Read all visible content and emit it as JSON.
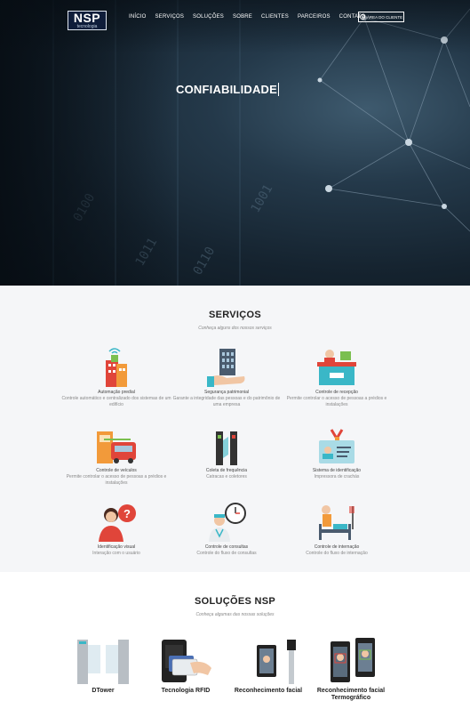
{
  "header": {
    "logo_text": "NSP",
    "logo_sub": "tecnologia",
    "nav": [
      "INÍCIO",
      "SERVIÇOS",
      "SOLUÇÕES",
      "SOBRE",
      "CLIENTES",
      "PARCEIROS",
      "CONTATO"
    ],
    "client_button": "ÁREA DO CLIENTE"
  },
  "hero": {
    "title": "CONFIABILIDADE"
  },
  "services": {
    "title": "SERVIÇOS",
    "subtitle": "Conheça alguns dos nossos serviços",
    "items": [
      {
        "title": "Automação predial",
        "desc": "Controle automático e centralizado dos sistemas de um edifício",
        "icon": "building-wifi-icon"
      },
      {
        "title": "Segurança patrimonial",
        "desc": "Garante a integridade das pessoas e do patrimônio de uma empresa",
        "icon": "building-hand-icon"
      },
      {
        "title": "Controle de recepção",
        "desc": "Permite controlar o acesso de pessoas a prédios e instalações",
        "icon": "reception-desk-icon"
      },
      {
        "title": "Controle de veículos",
        "desc": "Permite controlar o acesso de pessoas a prédios e instalações",
        "icon": "vehicle-gate-icon"
      },
      {
        "title": "Coleta de frequência",
        "desc": "Catracas e coletores",
        "icon": "turnstile-icon"
      },
      {
        "title": "Sistema de identificação",
        "desc": "Impressora de crachás",
        "icon": "id-badge-icon"
      },
      {
        "title": "Identificação visual",
        "desc": "Interação com o usuário",
        "icon": "person-question-icon"
      },
      {
        "title": "Controle de consultas",
        "desc": "Controle do fluxo de consultas",
        "icon": "doctor-clock-icon"
      },
      {
        "title": "Controle de internação",
        "desc": "Controle do fluxo de internação",
        "icon": "hospital-bed-icon"
      }
    ]
  },
  "solutions": {
    "title": "SOLUÇÕES NSP",
    "subtitle": "Conheça algumas das nossas soluções",
    "items": [
      {
        "label": "DTower",
        "icon": "gate-tower-icon"
      },
      {
        "label": "Tecnologia RFID",
        "icon": "rfid-card-icon"
      },
      {
        "label": "Reconhecimento facial",
        "icon": "face-terminal-icon"
      },
      {
        "label": "Reconhecimento facial Termográfico",
        "icon": "thermal-terminal-icon"
      }
    ]
  },
  "colors": {
    "hero_dark": "#15232f",
    "services_bg": "#f5f6f8",
    "accent_red": "#e0453a",
    "accent_teal": "#3ab7c7",
    "accent_navy": "#0f1d3a"
  }
}
